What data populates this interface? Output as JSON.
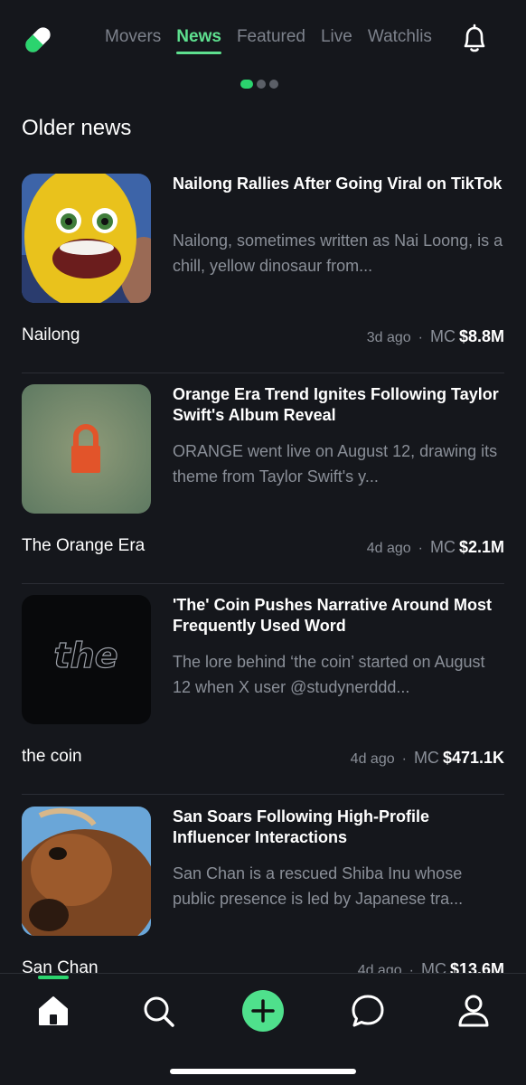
{
  "topnav": {
    "logo": "pill-logo-icon",
    "tabs": [
      {
        "label": "Movers",
        "active": false
      },
      {
        "label": "News",
        "active": true
      },
      {
        "label": "Featured",
        "active": false
      },
      {
        "label": "Live",
        "active": false
      },
      {
        "label": "Watchlist",
        "active": false
      }
    ],
    "bell": "bell-icon",
    "pager": {
      "count": 3,
      "active_index": 0
    }
  },
  "section_title": "Older news",
  "news": [
    {
      "headline": "Nailong Rallies After Going Viral on TikTok",
      "excerpt": "Nailong, sometimes written as Nai Loong, is a chill, yellow dinosaur from...",
      "coin": "Nailong",
      "age": "3d ago",
      "mc_label": "MC",
      "mc_value": "$8.8M"
    },
    {
      "headline": "Orange Era Trend Ignites Following Taylor Swift's Album Reveal",
      "excerpt": "ORANGE went live on August 12, drawing its theme from Taylor Swift's y...",
      "coin": "The Orange Era",
      "age": "4d ago",
      "mc_label": "MC",
      "mc_value": "$2.1M"
    },
    {
      "headline": "'The' Coin Pushes Narrative Around Most Frequently Used Word",
      "excerpt": "The lore behind ‘the coin’ started on August 12 when X user @studynerddd...",
      "coin": "the coin",
      "age": "4d ago",
      "mc_label": "MC",
      "mc_value": "$471.1K",
      "thumb_text": "the"
    },
    {
      "headline": "San Soars Following High-Profile Influencer Interactions",
      "excerpt": "San Chan is a rescued Shiba Inu whose public presence is led by Japanese tra...",
      "coin": "San Chan",
      "age": "4d ago",
      "mc_label": "MC",
      "mc_value": "$13.6M"
    }
  ],
  "bottom_nav": [
    "home-icon",
    "search-icon",
    "create-plus-icon",
    "chat-icon",
    "profile-icon"
  ],
  "colors": {
    "accent": "#2bd46e",
    "background": "#15171c",
    "muted": "#8a8f98"
  }
}
